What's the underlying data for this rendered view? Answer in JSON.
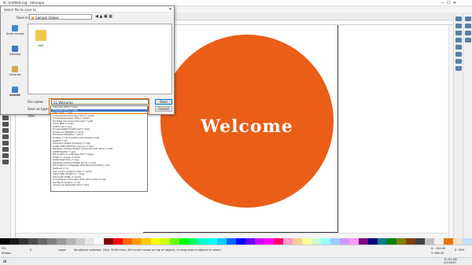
{
  "app": {
    "window_title": "IS: Untitled.svg - Inkscape",
    "canvas_text": "Welcome",
    "circle_color": "#ea5e17",
    "text_color": "#ffffff"
  },
  "dialog": {
    "title": "Select file to save to",
    "save_in_label": "Save in:",
    "save_in_value": "Sample Videos",
    "places": [
      {
        "label": "Quick access",
        "icon": "star-icon"
      },
      {
        "label": "Desktop",
        "icon": "desktop-icon"
      },
      {
        "label": "Libraries",
        "icon": "library-icon"
      },
      {
        "label": "This PC",
        "icon": "pc-icon"
      },
      {
        "label": "Network",
        "icon": "network-icon"
      }
    ],
    "folder_label": "AAA",
    "file_name_label": "File name:",
    "file_name_value": "01 Welcome",
    "save_type_label": "Save as type:",
    "save_type_value": "Inkscape SVG (*.svg)",
    "title_label": "Title:",
    "save_button": "Save",
    "cancel_button": "Cancel",
    "type_options": [
      "Inkscape SVG (*.svg)",
      "Inkscape SVG (*.svg)",
      "Plain SVG (*.svg)",
      "Compressed Inkscape SVG (*.svgz)",
      "Compressed plain SVG (*.svgz)",
      "Portable Document Format (*.pdf)",
      "Cairo PNG (*.png)",
      "PostScript (*.ps)",
      "Encapsulated PostScript (*.eps)",
      "Enhanced Metafile (*.emf)",
      "Windows Metafile (*.wmf)",
      "PovRay (*.pov) (paths and shapes only)",
      "JavaFX (*.fx)",
      "OpenDocument drawing (*.odg)",
      "LaTeX With PSTricks macros (*.tex)",
      "Desktop Cutting Plotter (AutoCAD DXF R14) (*.dxf)",
      "GIMP Palette (*.gpl)",
      "HP Graphics Language file (*.hpgl)",
      "HTML 5 canvas (*.html)",
      "Optimized SVG (*.svg)",
      "Desktop Cutting Plotter (R13) (*.dxf)",
      "HP Graphics Language Plot file [AutoCAD] (*.plt)",
      "Defined (*.cl)",
      "XAT vector graphics files (*.xaml)",
      "Flash XML Graphics (*.fxg)",
      "Microsoft XAML (*.xaml)",
      "Compressed Inkscape SVG with media (*.zip)",
      "Synfig Animation (*.sif)",
      "Layers as Separate SVG (*.tar)"
    ]
  },
  "statusbar": {
    "fill_label": "Fill:",
    "stroke_label": "Stroke:",
    "opacity": "0",
    "layer": "Layer",
    "message": "No objects selected. Click, Shift+click, Alt+scroll mouse on top of objects, or drag around objects to select.",
    "x_coord": "X: -134.40",
    "y_coord": "Y: 436.45",
    "zoom": "Z: 59%",
    "time": "12:03 AM",
    "date": "4/1/2020"
  },
  "palette_colors": [
    "#000000",
    "#1a1a1a",
    "#333333",
    "#4d4d4d",
    "#666666",
    "#808080",
    "#999999",
    "#b3b3b3",
    "#cccccc",
    "#e6e6e6",
    "#ffffff",
    "#800000",
    "#ff0000",
    "#ff6600",
    "#ff9900",
    "#ffcc00",
    "#ffff00",
    "#ccff00",
    "#66ff00",
    "#00ff00",
    "#00ff66",
    "#00ffcc",
    "#00ffff",
    "#00ccff",
    "#0066ff",
    "#0000ff",
    "#6600ff",
    "#cc00ff",
    "#ff00ff",
    "#ff0066",
    "#ff99cc",
    "#ffcc99",
    "#ffff99",
    "#ccffcc",
    "#99ffff",
    "#99ccff",
    "#cc99ff",
    "#ff99ff",
    "#800080",
    "#000080",
    "#008080",
    "#008000",
    "#808000",
    "#804000",
    "#404040",
    "#c0c0c0",
    "#f0f0f0",
    "#e8720c",
    "#ffe0c0",
    "#c0e0ff"
  ]
}
